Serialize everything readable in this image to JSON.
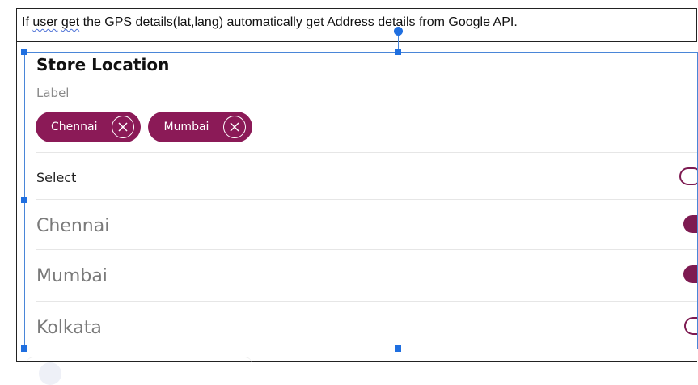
{
  "doc": {
    "sentence_prefix": "If ",
    "word_user": "user",
    "space1": " ",
    "word_get": "get",
    "sentence_rest": " the GPS details(lat,lang) automatically get Address details from Google API."
  },
  "card": {
    "title": "Store Location",
    "label": "Label",
    "chips": [
      {
        "label": "Chennai"
      },
      {
        "label": "Mumbai"
      }
    ],
    "select_label": "Select",
    "options": [
      {
        "label": "Chennai",
        "selected": true
      },
      {
        "label": "Mumbai",
        "selected": true
      },
      {
        "label": "Kolkata",
        "selected": false
      }
    ]
  },
  "colors": {
    "chip_bg": "#8b1a57",
    "accent": "#7d1a51",
    "selection_blue": "#1f6fe0"
  }
}
